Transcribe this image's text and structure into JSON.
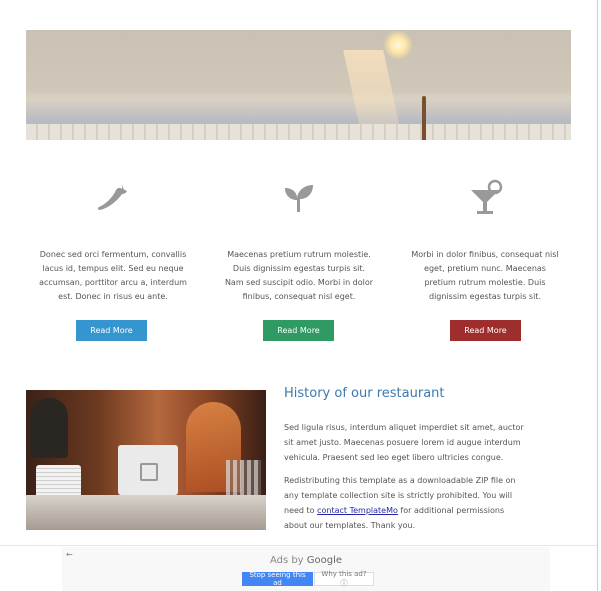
{
  "features": [
    {
      "icon": "chili-pepper-icon",
      "text": "Donec sed orci fermentum, convallis lacus id, tempus elit. Sed eu neque accumsan, porttitor arcu a, interdum est. Donec in risus eu ante.",
      "button_label": "Read More",
      "button_color": "#3595cf"
    },
    {
      "icon": "sprout-leaf-icon",
      "text": "Maecenas pretium rutrum molestie. Duis dignissim egestas turpis sit. Nam sed suscipit odio. Morbi in dolor finibus, consequat nisl eget.",
      "button_label": "Read More",
      "button_color": "#2f9a62"
    },
    {
      "icon": "cocktail-glass-icon",
      "text": "Morbi in dolor finibus, consequat nisl eget, pretium nunc. Maecenas pretium rutrum molestie. Duis dignissim egestas turpis sit.",
      "button_label": "Read More",
      "button_color": "#9e2e2e"
    }
  ],
  "history": {
    "title": "History of our restaurant",
    "paragraph1": "Sed ligula risus, interdum aliquet imperdiet sit amet, auctor sit amet justo. Maecenas posuere lorem id augue interdum vehicula. Praesent sed leo eget libero ultricies congue.",
    "paragraph2_before": "Redistributing this template as a downloadable ZIP file on any template collection site is strictly prohibited. You will need to ",
    "paragraph2_link": "contact TemplateMo",
    "paragraph2_after": " for additional permissions about our templates. Thank you."
  },
  "ad": {
    "back_arrow": "←",
    "ads_by": "Ads by",
    "google": "Google",
    "stop_button": "Stop seeing this ad",
    "why_button": "Why this ad? ⓘ"
  },
  "colors": {
    "icon_gray": "#999999",
    "title_blue": "#3c79b0",
    "link_color": "#2727a6",
    "ad_button_blue": "#4285f4"
  }
}
